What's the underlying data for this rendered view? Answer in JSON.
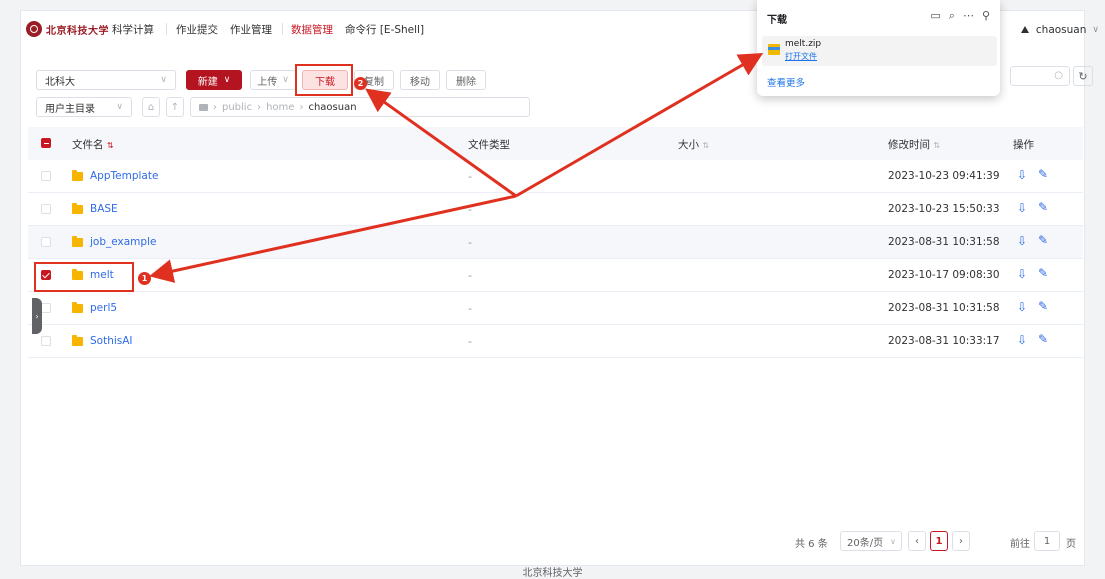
{
  "nav": {
    "logo_text": "北京科技大学",
    "items": [
      {
        "label": "科学计算"
      },
      {
        "label": "作业提交"
      },
      {
        "label": "作业管理"
      },
      {
        "label": "数据管理"
      },
      {
        "label": "命令行 [E-Shell]"
      }
    ],
    "active": "数据管理",
    "username": "chaosuan"
  },
  "toolbar": {
    "site_select": "北科大",
    "new_label": "新建",
    "upload_label": "上传",
    "download_label": "下载",
    "copy_label": "复制",
    "move_label": "移动",
    "delete_label": "删除",
    "dir_select": "用户主目录",
    "breadcrumb": [
      "public",
      "home",
      "chaosuan"
    ]
  },
  "table": {
    "headers": {
      "name": "文件名",
      "type": "文件类型",
      "size": "大小",
      "mtime": "修改时间",
      "ops": "操作"
    },
    "rows": [
      {
        "name": "AppTemplate",
        "type": "-",
        "mtime": "2023-10-23 09:41:39",
        "checked": false
      },
      {
        "name": "BASE",
        "type": "-",
        "mtime": "2023-10-23 15:50:33",
        "checked": false
      },
      {
        "name": "job_example",
        "type": "-",
        "mtime": "2023-08-31 10:31:58",
        "checked": false
      },
      {
        "name": "melt",
        "type": "-",
        "mtime": "2023-10-17 09:08:30",
        "checked": true
      },
      {
        "name": "perl5",
        "type": "-",
        "mtime": "2023-08-31 10:31:58",
        "checked": false
      },
      {
        "name": "SothisAI",
        "type": "-",
        "mtime": "2023-08-31 10:33:17",
        "checked": false
      }
    ]
  },
  "pagination": {
    "total": "共 6 条",
    "page_size": "20条/页",
    "current_page": "1",
    "goto_prefix": "前往",
    "goto_value": "1",
    "goto_suffix": "页"
  },
  "footer": "北京科技大学",
  "download_panel": {
    "title": "下载",
    "file_name": "melt.zip",
    "open_label": "打开文件",
    "more_label": "查看更多"
  },
  "annotations": {
    "step1": "1",
    "step2": "2"
  },
  "colors": {
    "brand": "#b3141f",
    "link": "#2e6be6",
    "annotation": "#e03020"
  }
}
